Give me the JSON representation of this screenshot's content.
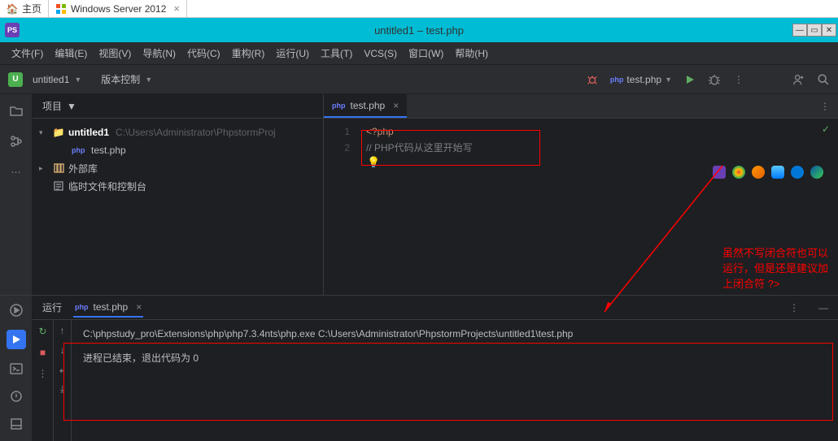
{
  "browser_tabs": [
    {
      "label": "主页",
      "icon": "home"
    },
    {
      "label": "Windows Server 2012",
      "icon": "windows",
      "closable": true
    }
  ],
  "window_title": "untitled1 – test.php",
  "menu": [
    "文件(F)",
    "编辑(E)",
    "视图(V)",
    "导航(N)",
    "代码(C)",
    "重构(R)",
    "运行(U)",
    "工具(T)",
    "VCS(S)",
    "窗口(W)",
    "帮助(H)"
  ],
  "toolbar": {
    "project": "untitled1",
    "vcs": "版本控制",
    "run_config": "test.php"
  },
  "project_panel": {
    "title": "项目",
    "tree": {
      "root": {
        "name": "untitled1",
        "path": "C:\\Users\\Administrator\\PhpstormProj"
      },
      "file": "test.php",
      "ext_lib": "外部库",
      "scratch": "临时文件和控制台"
    }
  },
  "editor": {
    "tab": "test.php",
    "lines": {
      "n1": "1",
      "n2": "2",
      "l1": "<?php",
      "l2": "// PHP代码从这里开始写"
    }
  },
  "annotation_text": "虽然不写闭合符也可以运行，但是还是建议加上闭合符  ?>",
  "run": {
    "title": "运行",
    "tab": "test.php",
    "cmd": "C:\\phpstudy_pro\\Extensions\\php\\php7.3.4nts\\php.exe C:\\Users\\Administrator\\PhpstormProjects\\untitled1\\test.php",
    "exit": "进程已结束，退出代码为 0"
  }
}
